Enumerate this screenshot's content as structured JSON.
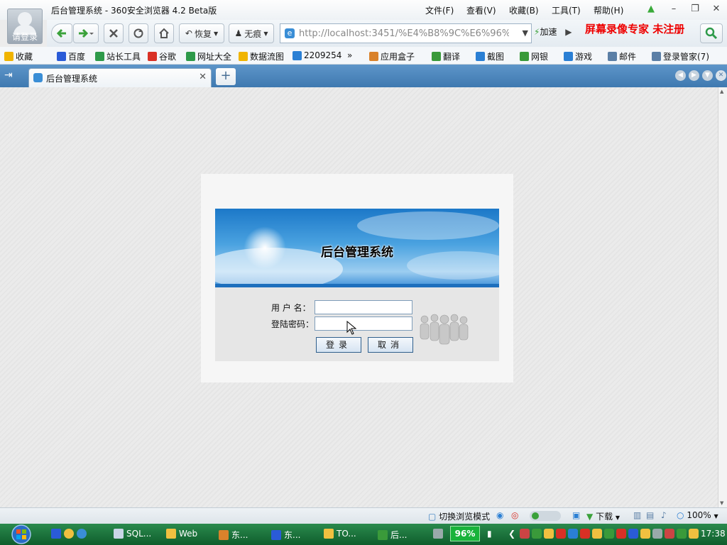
{
  "browser": {
    "window_title": "后台管理系统 - 360安全浏览器 4.2 Beta版",
    "login_label": "请登录",
    "menu": [
      "文件(F)",
      "查看(V)",
      "收藏(B)",
      "工具(T)",
      "帮助(H)"
    ],
    "nav": {
      "restore_label": "恢复",
      "incognito_label": "无痕",
      "address": "http://localhost:3451/%E4%B8%9C%E6%96%",
      "speed_label": "加速"
    },
    "watermark": "屏幕录像专家  未注册",
    "bookmarks": [
      {
        "label": "收藏",
        "color": "#f0b400"
      },
      {
        "label": "百度",
        "color": "#2a5bd7"
      },
      {
        "label": "站长工具",
        "color": "#2e9a4a"
      },
      {
        "label": "谷歌",
        "color": "#d93025"
      },
      {
        "label": "网址大全",
        "color": "#2e9a4a"
      },
      {
        "label": "数据流图",
        "color": "#f0b400"
      },
      {
        "label": "2209254",
        "color": "#2a7fd4"
      },
      {
        "label": "应用盒子",
        "color": "#d9822b"
      },
      {
        "label": "翻译",
        "color": "#3a9a3a"
      },
      {
        "label": "截图",
        "color": "#2a7fd4"
      },
      {
        "label": "网银",
        "color": "#3a9a3a"
      },
      {
        "label": "游戏",
        "color": "#2a7fd4"
      },
      {
        "label": "邮件",
        "color": "#5b7fa6"
      },
      {
        "label": "登录管家(7)",
        "color": "#5b7fa6"
      }
    ],
    "tab": {
      "title": "后台管理系统"
    },
    "status": {
      "switch_mode_label": "切换浏览模式",
      "download_label": "下载",
      "zoom": "100%"
    }
  },
  "page": {
    "banner_title": "后台管理系统",
    "username_label": "用 户 名：",
    "password_label": "登陆密码：",
    "username_value": "",
    "password_value": "",
    "login_button": "登录",
    "cancel_button": "取消"
  },
  "taskbar": {
    "items": [
      {
        "label": "SQL...",
        "color": "#c9d6e6"
      },
      {
        "label": "Web",
        "color": "#f0c040"
      },
      {
        "label": "东...",
        "color": "#d9822b"
      },
      {
        "label": "东...",
        "color": "#2a5bd7"
      },
      {
        "label": "TO...",
        "color": "#f0c040"
      },
      {
        "label": "后...",
        "color": "#3a9a3a"
      }
    ],
    "battery": "96%",
    "clock": "17:38"
  }
}
